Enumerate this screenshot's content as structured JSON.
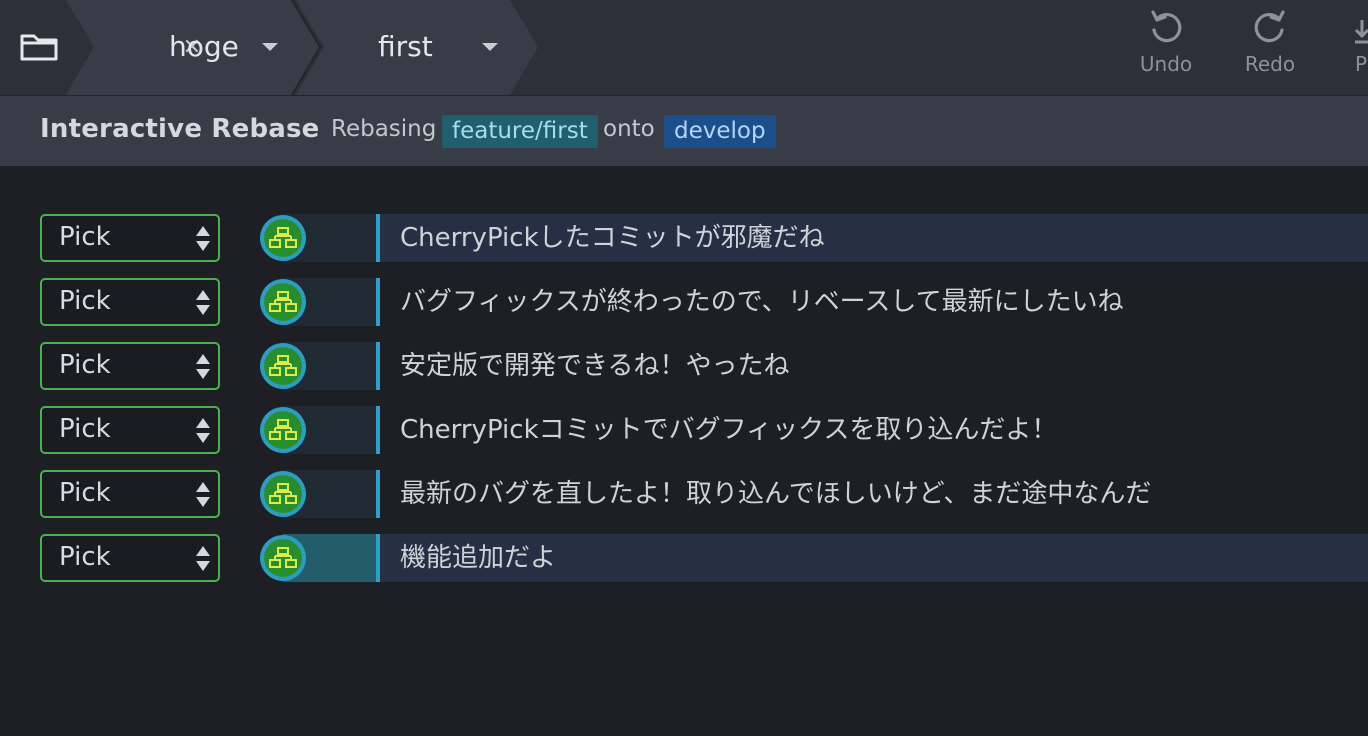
{
  "toolbar": {
    "repo_icon": "folder-icon",
    "repository": {
      "close_icon": "close-icon",
      "label": "hoge"
    },
    "branch": {
      "label": "first"
    },
    "undo": {
      "icon": "undo-icon",
      "label": "Undo"
    },
    "redo": {
      "icon": "redo-icon",
      "label": "Redo"
    },
    "pull": {
      "icon": "pull-icon",
      "label": "P"
    }
  },
  "subheader": {
    "title": "Interactive Rebase",
    "rebasing": "Rebasing",
    "source_branch": "feature/first",
    "onto": "onto",
    "target_branch": "develop"
  },
  "colors": {
    "select_border": "#4caf50",
    "graph_line": "#2aa1c7",
    "branch_pill": "#1f5f6e",
    "target_pill": "#1a4f8c"
  },
  "commits": [
    {
      "action": "Pick",
      "message": "CherryPickしたコミットが邪魔だね",
      "highlighted": true,
      "active": false
    },
    {
      "action": "Pick",
      "message": "バグフィックスが終わったので、リベースして最新にしたいね",
      "highlighted": false,
      "active": false
    },
    {
      "action": "Pick",
      "message": "安定版で開発できるね！やったね",
      "highlighted": false,
      "active": false
    },
    {
      "action": "Pick",
      "message": "CherryPickコミットでバグフィックスを取り込んだよ！",
      "highlighted": false,
      "active": false
    },
    {
      "action": "Pick",
      "message": "最新のバグを直したよ！取り込んでほしいけど、まだ途中なんだ",
      "highlighted": false,
      "active": false
    },
    {
      "action": "Pick",
      "message": "機能追加だよ",
      "highlighted": true,
      "active": true
    }
  ]
}
